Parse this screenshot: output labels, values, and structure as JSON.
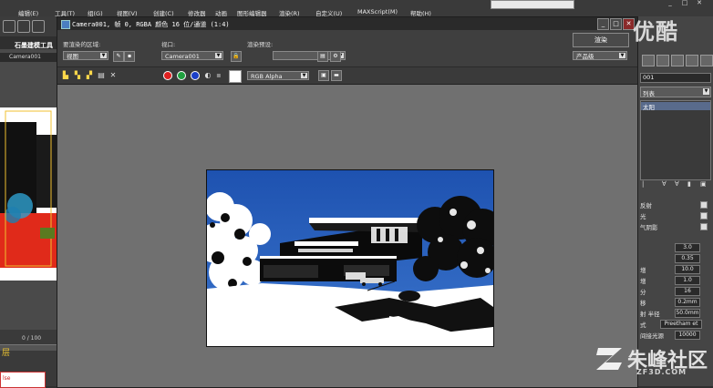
{
  "menubar": {
    "items": [
      "编辑(E)",
      "工具(T)",
      "组(G)",
      "视图(V)",
      "创建(C)",
      "修改器",
      "动画",
      "图形编辑器",
      "渲染(R)",
      "自定义(U)",
      "MAXScript(M)",
      "帮助(H)"
    ]
  },
  "left": {
    "ribbon_label": "石墨建模工具",
    "viewport_label": "Camera001",
    "timeline": "0 / 100",
    "status_prefix": "层",
    "field_text": "lse"
  },
  "render_window": {
    "title": "Camera001, 帧 0, RGBA 颜色 16 位/通道 (1:4)",
    "area_label": "要渲染的区域:",
    "area_value": "视图",
    "viewport_label": "视口:",
    "viewport_value": "Camera001",
    "preset_label": "渲染预设:",
    "preset_value": "",
    "render_button": "渲染",
    "product_value": "产品级",
    "channel_value": "RGB Alpha"
  },
  "right_panel": {
    "name_field": "001",
    "list_dropdown": "列表",
    "selected_item": "太阳",
    "rows": [
      {
        "label": "反射",
        "value": ""
      },
      {
        "label": "光",
        "value": ""
      },
      {
        "label": "气阴影",
        "value": ""
      },
      {
        "label": "",
        "value": "3.0"
      },
      {
        "label": "",
        "value": "0.35"
      },
      {
        "label": "增",
        "value": "10.0"
      },
      {
        "label": "增",
        "value": "1.0"
      },
      {
        "label": "分",
        "value": "16"
      },
      {
        "label": "移",
        "value": "0.2mm"
      },
      {
        "label": "射 半径",
        "value": "50.0mm"
      },
      {
        "label": "式",
        "value": "Preetham et"
      },
      {
        "label": "间接光源",
        "value": "10000"
      }
    ]
  },
  "watermarks": {
    "top": "优酷",
    "bottom_name": "朱峰社区",
    "bottom_url": "ZF3D.COM"
  },
  "colors": {
    "sky": "#2e5fb5",
    "channel_red": "#e02020",
    "channel_green": "#20a040",
    "channel_blue": "#1a3fc8"
  }
}
